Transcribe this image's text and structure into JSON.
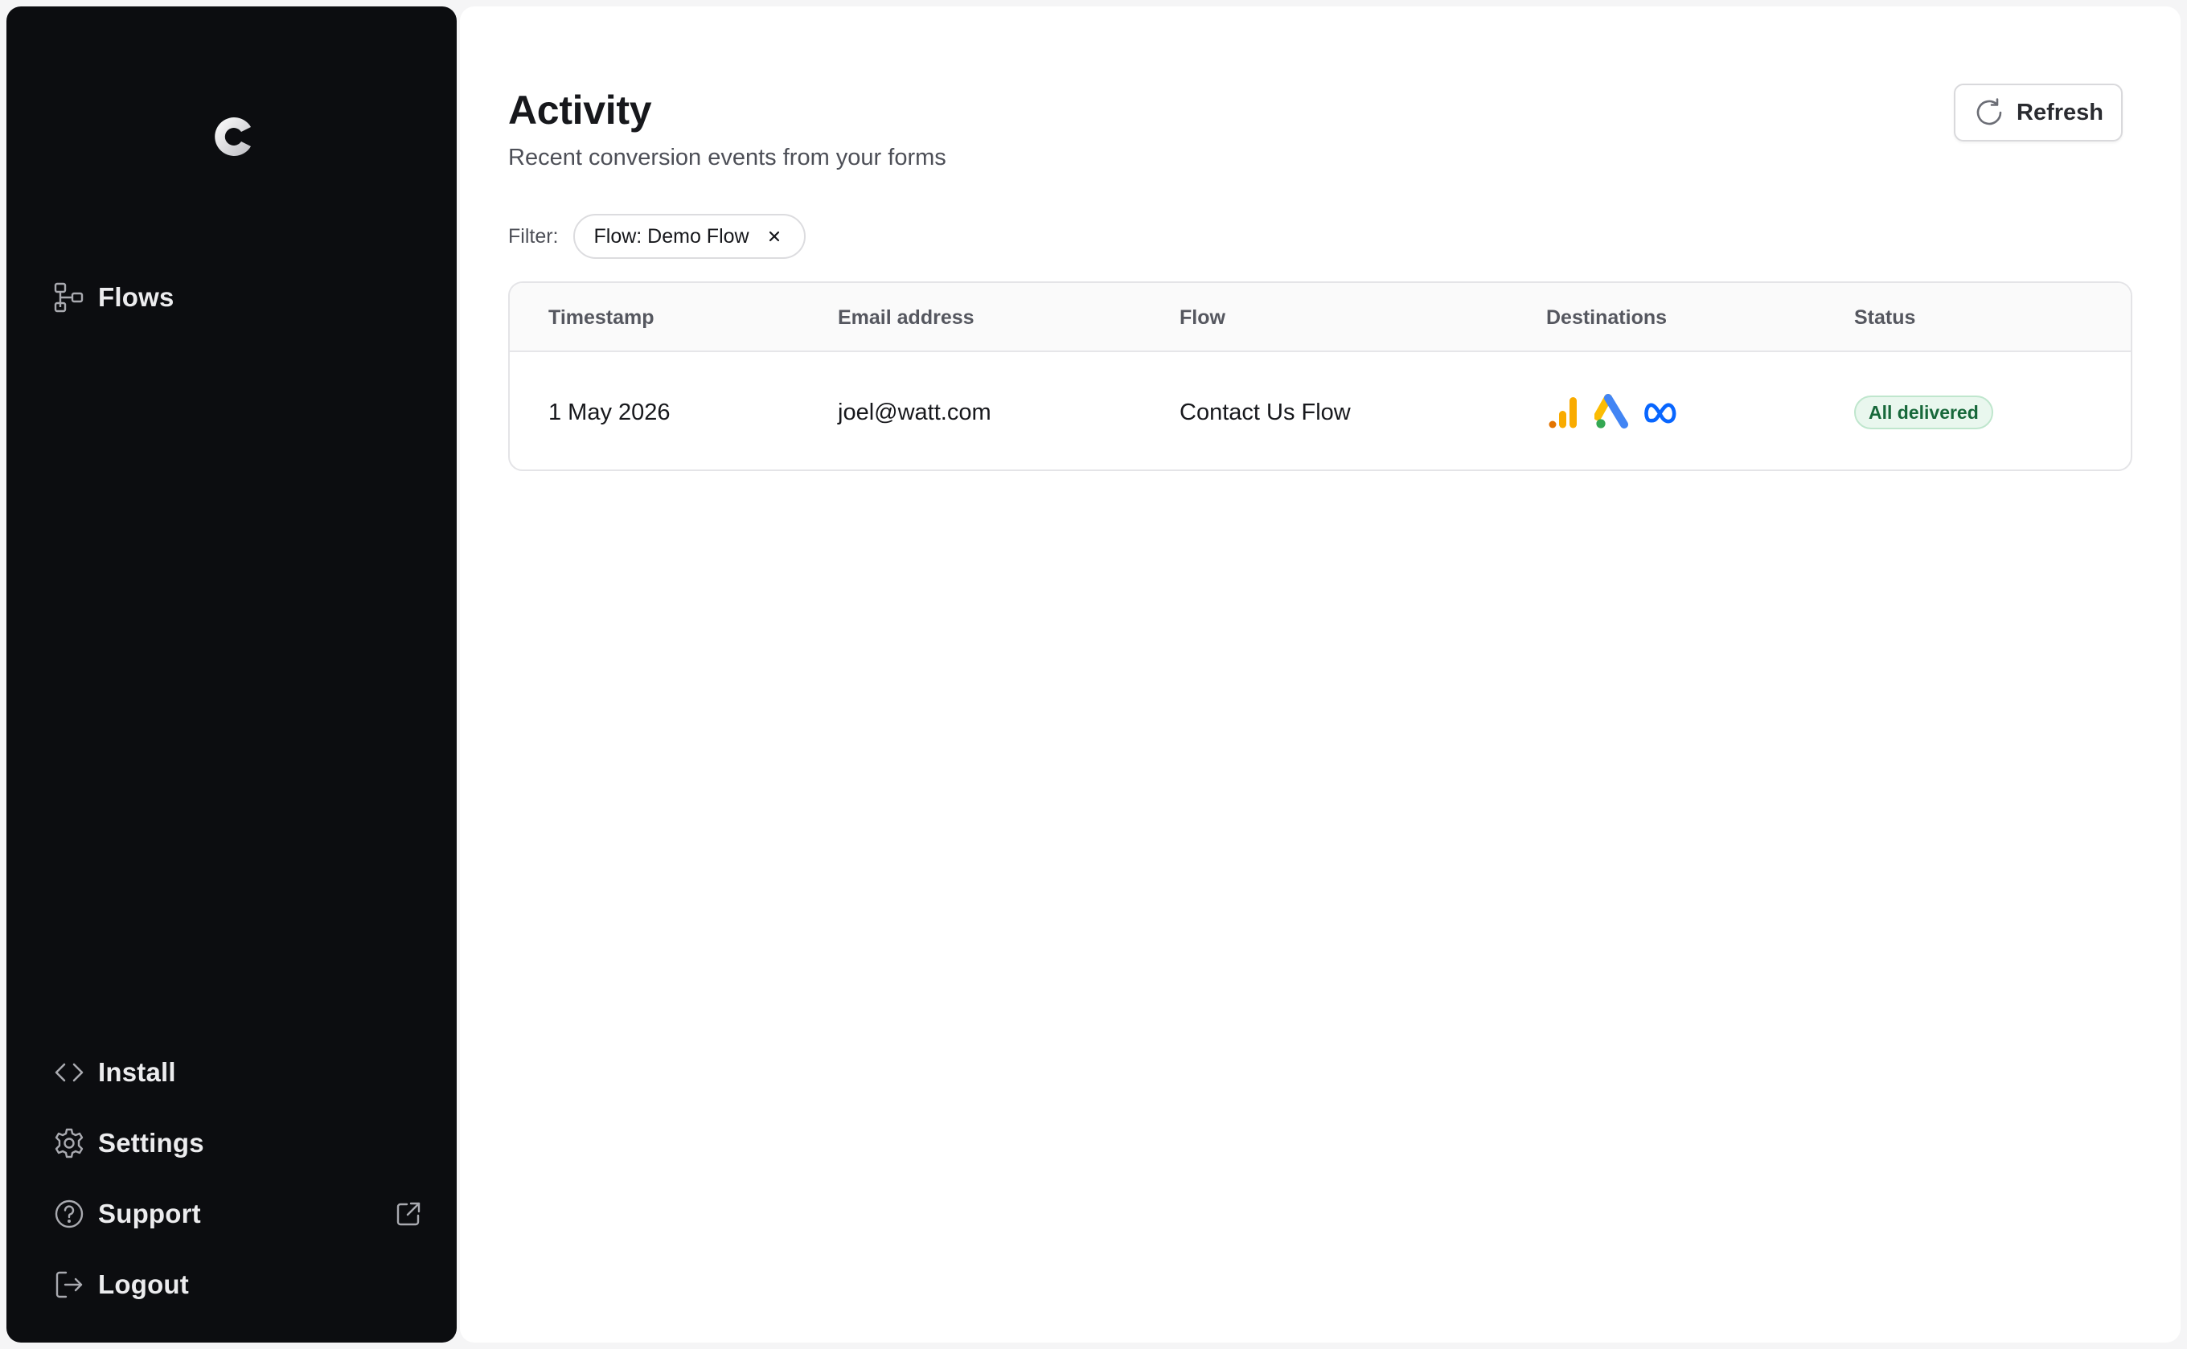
{
  "sidebar": {
    "logo_icon": "brand-c-logo",
    "items_top": [
      {
        "label": "Flows",
        "icon": "flows-icon"
      }
    ],
    "items_bottom": [
      {
        "label": "Install",
        "icon": "code-icon"
      },
      {
        "label": "Settings",
        "icon": "gear-icon"
      },
      {
        "label": "Support",
        "icon": "help-circle-icon",
        "external_icon": "external-link-icon"
      },
      {
        "label": "Logout",
        "icon": "logout-icon"
      }
    ]
  },
  "header": {
    "title": "Activity",
    "subtitle": "Recent conversion events from your forms",
    "refresh_label": "Refresh"
  },
  "filter": {
    "label": "Filter:",
    "chip_label": "Flow: Demo Flow"
  },
  "table": {
    "columns": [
      "Timestamp",
      "Email address",
      "Flow",
      "Destinations",
      "Status"
    ],
    "rows": [
      {
        "timestamp": "1 May 2026",
        "email": "joel@watt.com",
        "flow": "Contact Us Flow",
        "destinations": [
          "google-analytics-icon",
          "google-ads-icon",
          "meta-icon"
        ],
        "status": "All delivered"
      }
    ]
  },
  "colors": {
    "sidebar_bg": "#0c0d10",
    "status_green": "#17683a",
    "status_bg": "#e9f7ee"
  }
}
